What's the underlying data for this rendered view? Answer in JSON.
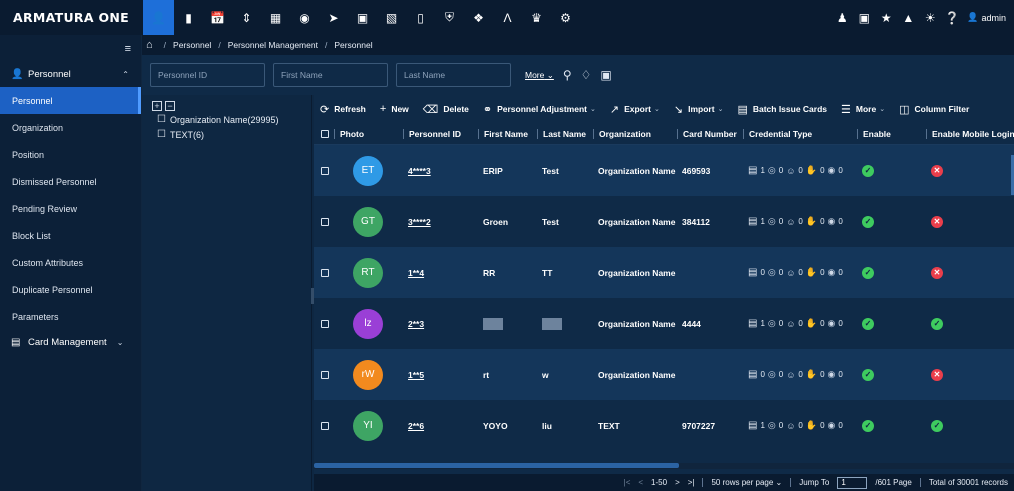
{
  "app": {
    "brand": "ARMATURA ONE",
    "user": "admin"
  },
  "topnav": {
    "icons": [
      "personnel-icon",
      "door-icon",
      "time-attendance-icon",
      "elevator-icon",
      "visitor-icon",
      "video-icon",
      "patrol-icon",
      "locker-icon",
      "building-icon",
      "intercom-icon",
      "shield-icon",
      "map-icon",
      "arrow-icon",
      "meeting-icon",
      "settings-icon"
    ],
    "right_icons": [
      "users-icon",
      "monitor-icon",
      "pin-icon",
      "bell-icon",
      "alarm-icon",
      "help-icon"
    ]
  },
  "sidebar": {
    "groups": [
      {
        "label": "Personnel",
        "items": [
          "Personnel",
          "Organization",
          "Position",
          "Dismissed Personnel",
          "Pending Review",
          "Block List",
          "Custom Attributes",
          "Duplicate Personnel",
          "Parameters"
        ]
      },
      {
        "label": "Card Management",
        "items": []
      }
    ],
    "active": "Personnel"
  },
  "breadcrumb": [
    "Personnel",
    "Personnel Management",
    "Personnel"
  ],
  "filters": {
    "personnel_id_placeholder": "Personnel ID",
    "first_name_placeholder": "First Name",
    "last_name_placeholder": "Last Name",
    "more_label": "More"
  },
  "tree": {
    "nodes": [
      {
        "label": "Organization Name(29995)"
      },
      {
        "label": "TEXT(6)"
      }
    ]
  },
  "toolbar": {
    "refresh": "Refresh",
    "new": "New",
    "delete": "Delete",
    "adjustment": "Personnel Adjustment",
    "export": "Export",
    "import": "Import",
    "batch": "Batch Issue Cards",
    "more": "More",
    "column_filter": "Column Filter"
  },
  "table": {
    "columns": [
      "Photo",
      "Personnel ID",
      "First Name",
      "Last Name",
      "Organization",
      "Card Number",
      "Credential Type",
      "Enable",
      "Enable Mobile Login"
    ],
    "rows": [
      {
        "initials": "ET",
        "color": "#2f9ae6",
        "pid": "4****3",
        "first": "ERIP",
        "last": "Test",
        "org": "Organization Name",
        "card": "469593",
        "cards": "1",
        "fp": "0",
        "face": "0",
        "palm": "0",
        "vein": "0",
        "enable": "on",
        "mobile": "off"
      },
      {
        "initials": "GT",
        "color": "#3ea564",
        "pid": "3****2",
        "first": "Groen",
        "last": "Test",
        "org": "Organization Name",
        "card": "384112",
        "cards": "1",
        "fp": "0",
        "face": "0",
        "palm": "0",
        "vein": "0",
        "enable": "on",
        "mobile": "off"
      },
      {
        "initials": "RT",
        "color": "#3ea564",
        "pid": "1**4",
        "first": "RR",
        "last": "TT",
        "org": "Organization Name",
        "card": "",
        "cards": "0",
        "fp": "0",
        "face": "0",
        "palm": "0",
        "vein": "0",
        "enable": "on",
        "mobile": "off"
      },
      {
        "initials": "lz",
        "color": "#9a3fd6",
        "pid": "2**3",
        "first": "",
        "last": "",
        "org": "Organization Name",
        "card": "4444",
        "cards": "1",
        "fp": "0",
        "face": "0",
        "palm": "0",
        "vein": "0",
        "enable": "on",
        "mobile": "on"
      },
      {
        "initials": "rW",
        "color": "#f28a1e",
        "pid": "1**5",
        "first": "rt",
        "last": "w",
        "org": "Organization Name",
        "card": "",
        "cards": "0",
        "fp": "0",
        "face": "0",
        "palm": "0",
        "vein": "0",
        "enable": "on",
        "mobile": "off"
      },
      {
        "initials": "YI",
        "color": "#3ea564",
        "pid": "2**6",
        "first": "YOYO",
        "last": "liu",
        "org": "TEXT",
        "card": "9707227",
        "cards": "1",
        "fp": "0",
        "face": "0",
        "palm": "0",
        "vein": "0",
        "enable": "on",
        "mobile": "on"
      }
    ]
  },
  "pager": {
    "range": "1-50",
    "per_page": "50 rows per page",
    "jump_label": "Jump To",
    "jump_value": "1",
    "pages": "/601 Page",
    "total": "Total of 30001 records"
  }
}
